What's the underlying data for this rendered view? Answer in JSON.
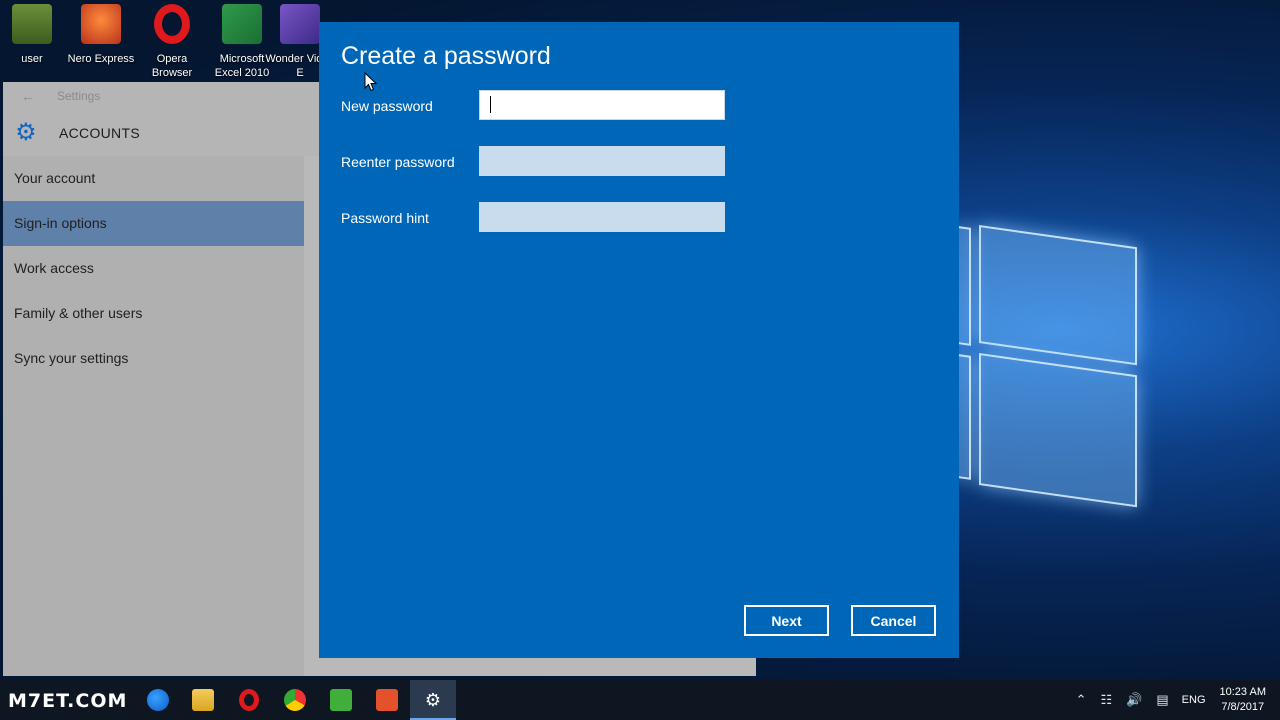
{
  "desktop": {
    "icons": [
      {
        "label": "user"
      },
      {
        "label": "Nero Express"
      },
      {
        "label": "Opera Browser"
      },
      {
        "label": "Microsoft Excel 2010"
      },
      {
        "label": "Wonder Video E"
      }
    ]
  },
  "settings": {
    "window_title": "Settings",
    "section_title": "ACCOUNTS",
    "nav": [
      {
        "label": "Your account"
      },
      {
        "label": "Sign-in options",
        "active": true
      },
      {
        "label": "Work access"
      },
      {
        "label": "Family & other users"
      },
      {
        "label": "Sync your settings"
      }
    ]
  },
  "dialog": {
    "title": "Create a password",
    "fields": [
      {
        "label": "New password",
        "value": ""
      },
      {
        "label": "Reenter password",
        "value": ""
      },
      {
        "label": "Password hint",
        "value": ""
      }
    ],
    "next_label": "Next",
    "cancel_label": "Cancel"
  },
  "taskbar": {
    "watermark": "M7ET.COM",
    "apps": [
      "edge",
      "file-explorer",
      "opera",
      "chrome",
      "camtasia-green",
      "camtasia-orange",
      "settings"
    ],
    "tray": {
      "language": "ENG",
      "time": "10:23 AM",
      "date": "7/8/2017"
    }
  },
  "colors": {
    "dialog_bg": "#0067b8",
    "active_nav": "#5f80a8"
  }
}
